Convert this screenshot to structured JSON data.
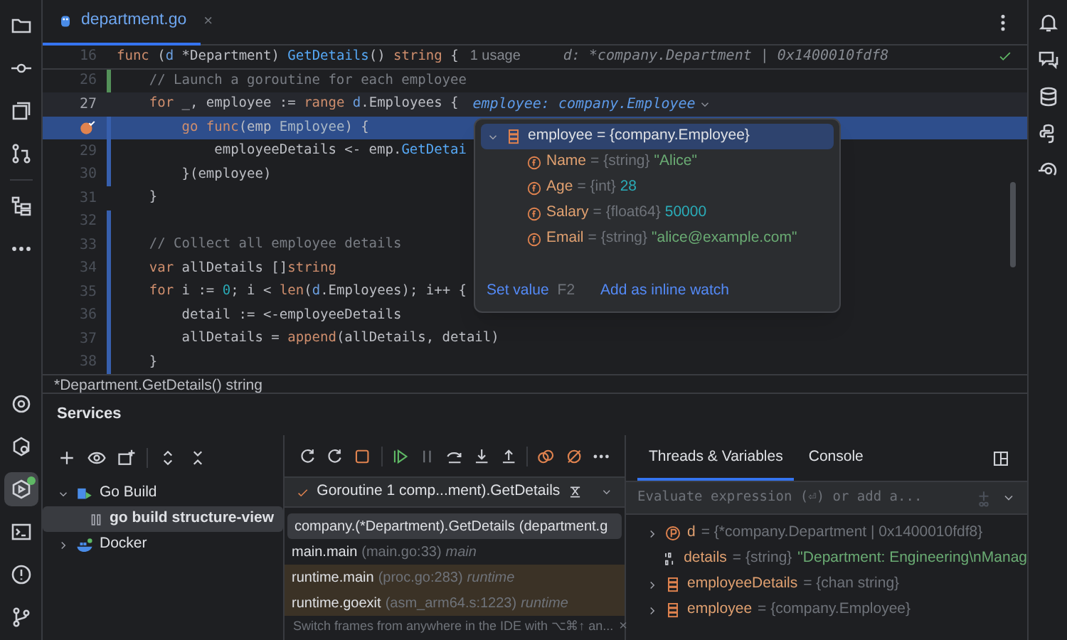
{
  "editor_tab": {
    "label": "department.go",
    "selected": true,
    "close": "×"
  },
  "code": [
    {
      "number": "16",
      "current": false,
      "breakpoint": false,
      "tokens": [
        {
          "text": "func ",
          "kind": "kw"
        },
        {
          "text": "(",
          "kind": "tx"
        },
        {
          "text": "d",
          "kind": "par"
        },
        {
          "text": " *Department) ",
          "kind": "tx"
        },
        {
          "text": "GetDetails",
          "kind": "fn"
        },
        {
          "text": "() ",
          "kind": "tx"
        },
        {
          "text": "string",
          "kind": "kw"
        },
        {
          "text": " {",
          "kind": "tx"
        }
      ],
      "hint": "1 usage",
      "inline_value": "d: *company.Department | 0x1400010fdf8"
    },
    {
      "number": "26",
      "color": "#549159",
      "current": false,
      "breakpoint": false,
      "tokens": [
        {
          "text": "    // Launch a goroutine for each employee",
          "kind": "cm"
        }
      ]
    },
    {
      "number": "27",
      "current": true,
      "breakpoint": false,
      "tokens": [
        {
          "text": "    for",
          "kind": "kw"
        },
        {
          "text": " _, employee := ",
          "kind": "tx"
        },
        {
          "text": "range ",
          "kind": "kw"
        },
        {
          "text": "d",
          "kind": "par"
        },
        {
          "text": ".Employees {",
          "kind": "tx"
        }
      ],
      "inline_value": "employee: company.Employee"
    },
    {
      "color": "#375fad",
      "current": false,
      "breakpoint": true,
      "tokens": [
        {
          "text": "        go ",
          "kind": "kw"
        },
        {
          "text": "func",
          "kind": "kw"
        },
        {
          "text": "(emp ",
          "kind": "tx"
        },
        {
          "text": "Employee",
          "kind": "ty"
        },
        {
          "text": ") {",
          "kind": "tx"
        }
      ]
    },
    {
      "number": "29",
      "color": "#375fad",
      "current": false,
      "breakpoint": false,
      "tokens": [
        {
          "text": "            employeeDetails <- emp.",
          "kind": "tx"
        },
        {
          "text": "GetDetai",
          "kind": "fn"
        }
      ]
    },
    {
      "number": "30",
      "color": "#375fad",
      "current": false,
      "breakpoint": false,
      "tokens": [
        {
          "text": "        }(employee)",
          "kind": "tx"
        }
      ]
    },
    {
      "number": "31",
      "current": false,
      "breakpoint": false,
      "tokens": [
        {
          "text": "    }",
          "kind": "tx"
        }
      ]
    },
    {
      "number": "32",
      "color": "#375fad",
      "current": false,
      "breakpoint": false
    },
    {
      "number": "33",
      "color": "#375fad",
      "current": false,
      "breakpoint": false,
      "tokens": [
        {
          "text": "    // Collect all employee details",
          "kind": "cm"
        }
      ]
    },
    {
      "number": "34",
      "color": "#375fad",
      "current": false,
      "breakpoint": false,
      "tokens": [
        {
          "text": "    var",
          "kind": "kw"
        },
        {
          "text": " allDetails []",
          "kind": "tx"
        },
        {
          "text": "string",
          "kind": "kw"
        }
      ]
    },
    {
      "number": "35",
      "color": "#375fad",
      "current": false,
      "breakpoint": false,
      "tokens": [
        {
          "text": "    for",
          "kind": "kw"
        },
        {
          "text": " i := ",
          "kind": "tx"
        },
        {
          "text": "0",
          "kind": "num"
        },
        {
          "text": "; i < ",
          "kind": "tx"
        },
        {
          "text": "len",
          "kind": "kw"
        },
        {
          "text": "(",
          "kind": "tx"
        },
        {
          "text": "d",
          "kind": "par"
        },
        {
          "text": ".Employees); i++ {",
          "kind": "tx"
        }
      ]
    },
    {
      "number": "36",
      "color": "#375fad",
      "current": false,
      "breakpoint": false,
      "tokens": [
        {
          "text": "        detail := <-employeeDetails",
          "kind": "tx"
        }
      ]
    },
    {
      "number": "37",
      "color": "#375fad",
      "current": false,
      "breakpoint": false,
      "tokens": [
        {
          "text": "        allDetails = ",
          "kind": "tx"
        },
        {
          "text": "append",
          "kind": "kw"
        },
        {
          "text": "(allDetails, detail)",
          "kind": "tx"
        }
      ]
    },
    {
      "number": "38",
      "color": "#375fad",
      "current": false,
      "breakpoint": false,
      "tokens": [
        {
          "text": "    }",
          "kind": "tx"
        }
      ]
    }
  ],
  "breadcrumb": "*Department.GetDetails() string",
  "popup": {
    "root": "employee = {company.Employee}",
    "expanded": true,
    "fields": [
      {
        "name": "Name",
        "type": "= {string}",
        "value": "\"Alice\"",
        "kind": "string"
      },
      {
        "name": "Age",
        "type": "= {int}",
        "value": "28",
        "kind": "number"
      },
      {
        "name": "Salary",
        "type": "= {float64}",
        "value": "50000",
        "kind": "number"
      },
      {
        "name": "Email",
        "type": "= {string}",
        "value": "\"alice@example.com\"",
        "kind": "string"
      }
    ],
    "actions": [
      {
        "label": "Set value",
        "shortcut": "F2"
      },
      {
        "label": "Add as inline watch"
      }
    ]
  },
  "left_toolbar_bottom": [
    {
      "selected": false
    },
    {
      "selected": false
    },
    {
      "selected": true
    },
    {
      "selected": false
    },
    {
      "selected": false
    },
    {
      "selected": false
    }
  ],
  "services": {
    "title": "Services",
    "tree": [
      {
        "label": "Go Build",
        "expanded": true,
        "selected": false,
        "children": [
          {
            "label": "go build structure-view",
            "selected": true
          }
        ]
      },
      {
        "label": "Docker",
        "expanded": false,
        "selected": false
      }
    ]
  },
  "goroutine": "Goroutine 1 comp...ment).GetDetails",
  "frames": [
    {
      "name": "company.(*Department).GetDetails",
      "location": "(department.g",
      "selected": true,
      "library": false
    },
    {
      "name": "main.main",
      "location": "(main.go:33)",
      "package": "main",
      "selected": false,
      "library": false
    },
    {
      "name": "runtime.main",
      "location": "(proc.go:283)",
      "package": "runtime",
      "selected": false,
      "library": true
    },
    {
      "name": "runtime.goexit",
      "location": "(asm_arm64.s:1223)",
      "package": "runtime",
      "selected": false,
      "library": true
    }
  ],
  "frames_hint": "Switch frames from anywhere in the IDE with ⌥⌘↑ an...",
  "frames_hint_close": "×",
  "tabs": [
    {
      "label": "Threads & Variables",
      "selected": true
    },
    {
      "label": "Console",
      "selected": false
    }
  ],
  "evaluate": {
    "placeholder": "Evaluate expression (⏎) or add a..."
  },
  "variables": [
    {
      "kind": "pointer",
      "expandable": true,
      "name": "d",
      "type": "= {*company.Department | 0x1400010fdf8}"
    },
    {
      "kind": "bits",
      "expandable": false,
      "name": "details",
      "type": "= {string}",
      "value": "\"Department: Engineering\\nManag"
    },
    {
      "kind": "struct",
      "expandable": true,
      "name": "employeeDetails",
      "type": "= {chan string}"
    },
    {
      "kind": "struct",
      "expandable": true,
      "name": "employee",
      "type": "= {company.Employee}"
    }
  ]
}
